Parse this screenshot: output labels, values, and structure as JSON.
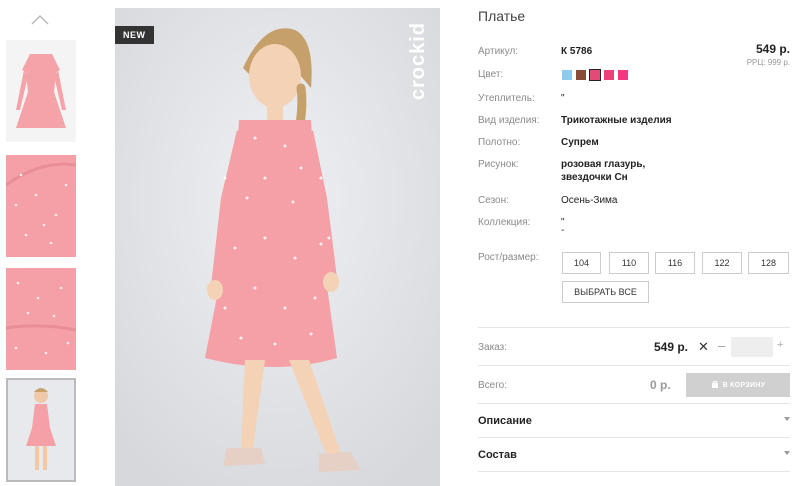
{
  "badge": "NEW",
  "brand": "crockid",
  "product": {
    "title": "Платье",
    "price": "549 р.",
    "rrp": "РРЦ: 999 р."
  },
  "specs": [
    {
      "label": "Артикул:",
      "value": "К 5786"
    },
    {
      "label": "Цвет:",
      "value": ""
    },
    {
      "label": "Утеплитель:",
      "value": "\""
    },
    {
      "label": "Вид изделия:",
      "value": "Трикотажные изделия"
    },
    {
      "label": "Полотно:",
      "value": "Супрем"
    },
    {
      "label": "Рисунок:",
      "value": "розовая глазурь,"
    },
    {
      "label": "",
      "value": "звездочки Сн"
    },
    {
      "label": "Сезон:",
      "value": "Осень-Зима"
    },
    {
      "label": "Коллекция:",
      "value": "\""
    },
    {
      "label": "",
      "value": "-"
    }
  ],
  "colors": [
    "#8ec9ef",
    "#8a4a3a",
    "#e24a78",
    "#f0407a",
    "#f2397f"
  ],
  "size_label": "Рост/размер:",
  "sizes": [
    "104",
    "110",
    "116",
    "122",
    "128"
  ],
  "select_all": "ВЫБРАТЬ ВСЕ",
  "order": {
    "label": "Заказ:",
    "price": "549 р.",
    "times": "✕",
    "minus": "–",
    "plus": "+",
    "total_label": "Всего:",
    "total_value": "0 р.",
    "cart_button": "В КОРЗИНУ"
  },
  "accordion": [
    "Описание",
    "Состав"
  ]
}
